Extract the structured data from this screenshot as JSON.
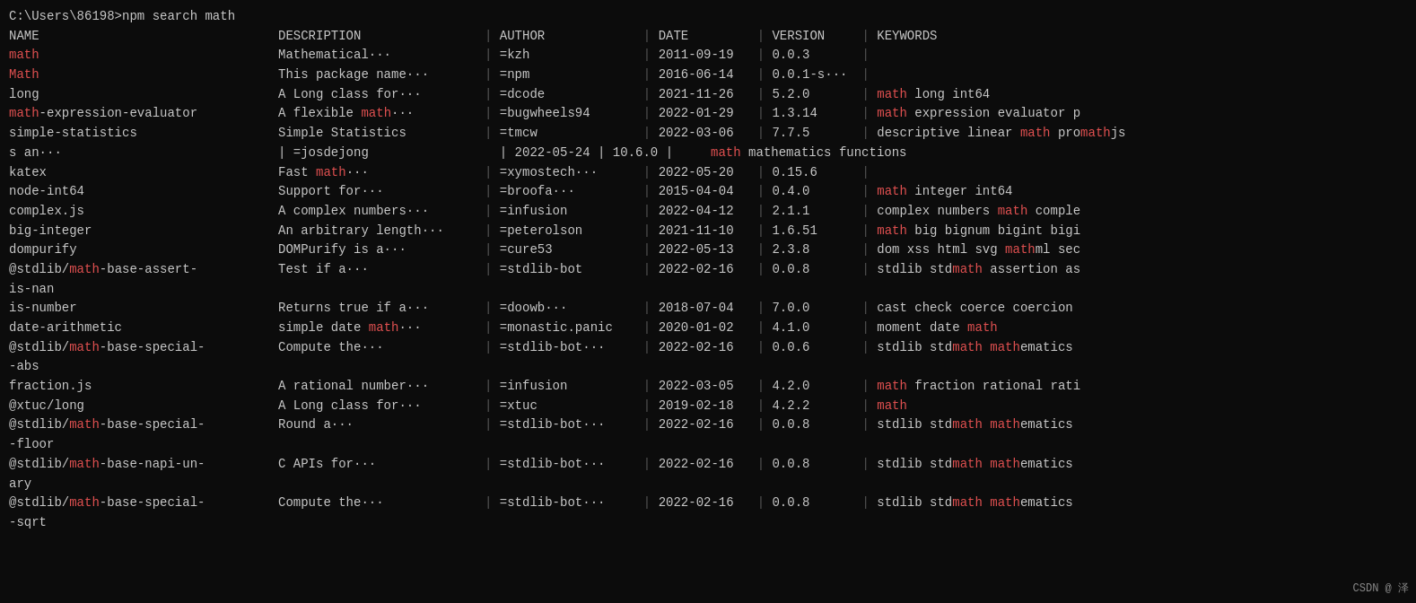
{
  "terminal": {
    "command": "C:\\Users\\86198>npm search math",
    "watermark": "CSDN @ 泽",
    "header": {
      "name": "NAME",
      "description": "DESCRIPTION",
      "author": "AUTHOR",
      "date": "DATE",
      "version": "VERSION",
      "keywords": "KEYWORDS"
    },
    "rows": [
      {
        "name": "math",
        "name_red": true,
        "description": "Mathematical···",
        "author": "=kzh",
        "date": "2011-09-19",
        "version": "0.0.3",
        "keywords": ""
      },
      {
        "name": "Math",
        "name_red": true,
        "description": "This package name···",
        "author": "=npm",
        "date": "2016-06-14",
        "version": "0.0.1-s···",
        "keywords": ""
      },
      {
        "name": "long",
        "name_red": false,
        "description": "A Long class for···",
        "author": "=dcode",
        "date": "2021-11-26",
        "version": "5.2.0",
        "keywords_parts": [
          {
            "text": "math",
            "red": true
          },
          {
            "text": " long int64",
            "red": false
          }
        ]
      },
      {
        "name": "math-expression-evaluator",
        "name_red_prefix": "math",
        "name_suffix": "-expression-evaluator",
        "description_parts": [
          {
            "text": "A flexible ",
            "red": false
          },
          {
            "text": "math",
            "red": true
          },
          {
            "text": "···",
            "red": false
          }
        ],
        "author": "=bugwheels94",
        "date": "2022-01-29",
        "version": "1.3.14",
        "keywords_parts": [
          {
            "text": "math",
            "red": true
          },
          {
            "text": " expression evaluator p",
            "red": false
          }
        ]
      },
      {
        "name": "simple-statistics",
        "name_red": false,
        "description": "Simple Statistics",
        "author": "=tmcw",
        "date": "2022-03-06",
        "version": "7.7.5",
        "keywords_parts": [
          {
            "text": "descriptive linear ",
            "red": false
          },
          {
            "text": "math",
            "red": true
          },
          {
            "text": " pro",
            "red": false
          },
          {
            "text": "math",
            "red": true
          },
          {
            "text": "js",
            "red": false
          }
        ]
      },
      {
        "name": "s an···",
        "name_red": false,
        "description": "| =josdejong",
        "middle_info": "| 2022-05-24 | 10.6.0 |",
        "keywords_parts": [
          {
            "text": "math",
            "red": true
          },
          {
            "text": " math",
            "red": false
          },
          {
            "text": "ematics functions",
            "red": false
          }
        ]
      },
      {
        "name": "katex",
        "name_red": false,
        "description_parts": [
          {
            "text": "Fast ",
            "red": false
          },
          {
            "text": "math",
            "red": true
          },
          {
            "text": "···",
            "red": false
          }
        ],
        "author": "=xymostech···",
        "date": "2022-05-20",
        "version": "0.15.6",
        "keywords": ""
      },
      {
        "name": "node-int64",
        "name_red": false,
        "description": "Support for···",
        "author": "=broofa···",
        "date": "2015-04-04",
        "version": "0.4.0",
        "keywords_parts": [
          {
            "text": "math",
            "red": true
          },
          {
            "text": " integer int64",
            "red": false
          }
        ]
      },
      {
        "name": "complex.js",
        "name_red": false,
        "description": "A complex numbers···",
        "author": "=infusion",
        "date": "2022-04-12",
        "version": "2.1.1",
        "keywords_parts": [
          {
            "text": "complex numbers ",
            "red": false
          },
          {
            "text": "math",
            "red": true
          },
          {
            "text": " comple",
            "red": false
          }
        ]
      },
      {
        "name": "big-integer",
        "name_red": false,
        "description": "An arbitrary length···",
        "author": "=peterolson",
        "date": "2021-11-10",
        "version": "1.6.51",
        "keywords_parts": [
          {
            "text": "math",
            "red": true
          },
          {
            "text": " big bignum bigint bigi",
            "red": false
          }
        ]
      },
      {
        "name": "dompurify",
        "name_red": false,
        "description": "DOMPurify is a···",
        "author": "=cure53",
        "date": "2022-05-13",
        "version": "2.3.8",
        "keywords_parts": [
          {
            "text": "dom xss html svg ",
            "red": false
          },
          {
            "text": "math",
            "red": true
          },
          {
            "text": "ml sec",
            "red": false
          }
        ]
      },
      {
        "name_parts": [
          {
            "text": "@stdlib/",
            "red": false
          },
          {
            "text": "math",
            "red": true
          },
          {
            "text": "-base-assert-",
            "red": false
          }
        ],
        "name_line2": "is-nan",
        "description": "Test if a···",
        "author": "=stdlib-bot",
        "date": "2022-02-16",
        "version": "0.0.8",
        "keywords_parts": [
          {
            "text": "stdlib std",
            "red": false
          },
          {
            "text": "math",
            "red": true
          },
          {
            "text": " assertion as",
            "red": false
          }
        ]
      },
      {
        "name": "is-number",
        "name_red": false,
        "description": "Returns true if a···",
        "author": "=doowb···",
        "date": "2018-07-04",
        "version": "7.0.0",
        "keywords": "cast check coerce coercion"
      },
      {
        "name": "date-arithmetic",
        "name_red": false,
        "description_parts": [
          {
            "text": "simple date ",
            "red": false
          },
          {
            "text": "math",
            "red": true
          },
          {
            "text": "···",
            "red": false
          }
        ],
        "author": "=monastic.panic",
        "date": "2020-01-02",
        "version": "4.1.0",
        "keywords_parts": [
          {
            "text": "moment date ",
            "red": false
          },
          {
            "text": "math",
            "red": true
          }
        ]
      },
      {
        "name_parts": [
          {
            "text": "@stdlib/",
            "red": false
          },
          {
            "text": "math",
            "red": true
          },
          {
            "text": "-base-special-",
            "red": false
          }
        ],
        "name_line2": "-abs",
        "description": "Compute the···",
        "author": "=stdlib-bot···",
        "date": "2022-02-16",
        "version": "0.0.6",
        "keywords_parts": [
          {
            "text": "stdlib std",
            "red": false
          },
          {
            "text": "math",
            "red": true
          },
          {
            "text": " math",
            "red": false
          },
          {
            "text": "ematics",
            "red": false
          }
        ]
      },
      {
        "name": "fraction.js",
        "name_red": false,
        "description": "A rational number···",
        "author": "=infusion",
        "date": "2022-03-05",
        "version": "4.2.0",
        "keywords_parts": [
          {
            "text": "math",
            "red": true
          },
          {
            "text": " fraction rational rati",
            "red": false
          }
        ]
      },
      {
        "name": "@xtuc/long",
        "name_red": false,
        "description": "A Long class for···",
        "author": "=xtuc",
        "date": "2019-02-18",
        "version": "4.2.2",
        "keywords_parts": [
          {
            "text": "math",
            "red": true
          }
        ]
      },
      {
        "name_parts": [
          {
            "text": "@stdlib/",
            "red": false
          },
          {
            "text": "math",
            "red": true
          },
          {
            "text": "-base-special-",
            "red": false
          }
        ],
        "name_line2": "-floor",
        "description": "Round a···",
        "author": "=stdlib-bot···",
        "date": "2022-02-16",
        "version": "0.0.8",
        "keywords_parts": [
          {
            "text": "stdlib std",
            "red": false
          },
          {
            "text": "math",
            "red": true
          },
          {
            "text": " math",
            "red": false
          },
          {
            "text": "ematics",
            "red": false
          }
        ]
      },
      {
        "name_parts": [
          {
            "text": "@stdlib/",
            "red": false
          },
          {
            "text": "math",
            "red": true
          },
          {
            "text": "-base-napi-un-",
            "red": false
          }
        ],
        "name_line2": "ary",
        "description": "C APIs for···",
        "author": "=stdlib-bot···",
        "date": "2022-02-16",
        "version": "0.0.8",
        "keywords_parts": [
          {
            "text": "stdlib std",
            "red": false
          },
          {
            "text": "math",
            "red": true
          },
          {
            "text": " math",
            "red": false
          },
          {
            "text": "ematics",
            "red": false
          }
        ]
      },
      {
        "name_parts": [
          {
            "text": "@stdlib/",
            "red": false
          },
          {
            "text": "math",
            "red": true
          },
          {
            "text": "-base-special-",
            "red": false
          }
        ],
        "name_line2": "-sqrt",
        "description": "Compute the···",
        "author": "=stdlib-bot···",
        "date": "2022-02-16",
        "version": "0.0.8",
        "keywords_parts": [
          {
            "text": "stdlib std",
            "red": false
          },
          {
            "text": "math",
            "red": true
          },
          {
            "text": " math",
            "red": false
          },
          {
            "text": "ematics",
            "red": false
          }
        ]
      }
    ]
  }
}
